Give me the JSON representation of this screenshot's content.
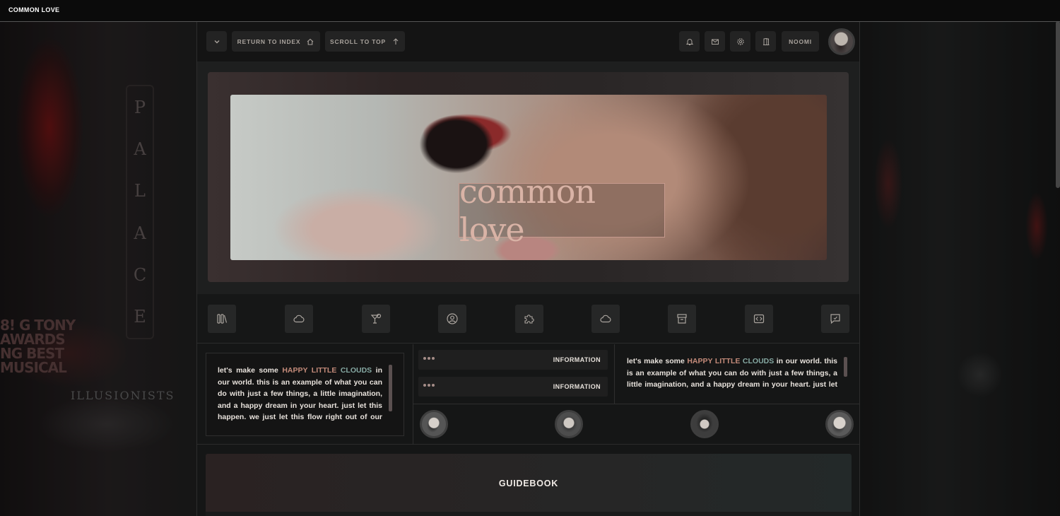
{
  "site": {
    "title": "COMMON LOVE"
  },
  "nav": {
    "return_label": "RETURN TO INDEX",
    "scroll_label": "SCROLL TO TOP",
    "user_label": "NOOMI"
  },
  "banner": {
    "logo_text": "common love"
  },
  "icon_row": [
    {
      "icon": "books-icon"
    },
    {
      "icon": "cloud-icon"
    },
    {
      "icon": "cocktail-icon"
    },
    {
      "icon": "user-circle-icon"
    },
    {
      "icon": "puzzle-icon"
    },
    {
      "icon": "cloud-icon"
    },
    {
      "icon": "archive-icon"
    },
    {
      "icon": "code-icon"
    },
    {
      "icon": "chat-icon"
    }
  ],
  "widgets": {
    "left_text": {
      "pre": "let's make some ",
      "hl1": "HAPPY LITTLE",
      "hl2": "CLOUDS",
      "post": " in our world. this is an example of what you can do with just a few things, a little imagination, and a happy dream in your heart. just let this happen. we just let this flow right out of our minds. we'll paint one"
    },
    "info_bars": [
      "INFORMATION",
      "INFORMATION"
    ],
    "right_text": {
      "pre": "let's make some ",
      "hl1": "HAPPY LITTLE",
      "hl2": "CLOUDS",
      "post": " in our world. this is an example of what you can do with just a few things, a little imagination, and a happy dream in your heart. just let this"
    }
  },
  "guide": {
    "title": "GUIDEBOOK"
  },
  "colors": {
    "accent_rose": "#c48b7a",
    "accent_teal": "#86a9a3",
    "panel": "#262727",
    "background": "#151616"
  }
}
